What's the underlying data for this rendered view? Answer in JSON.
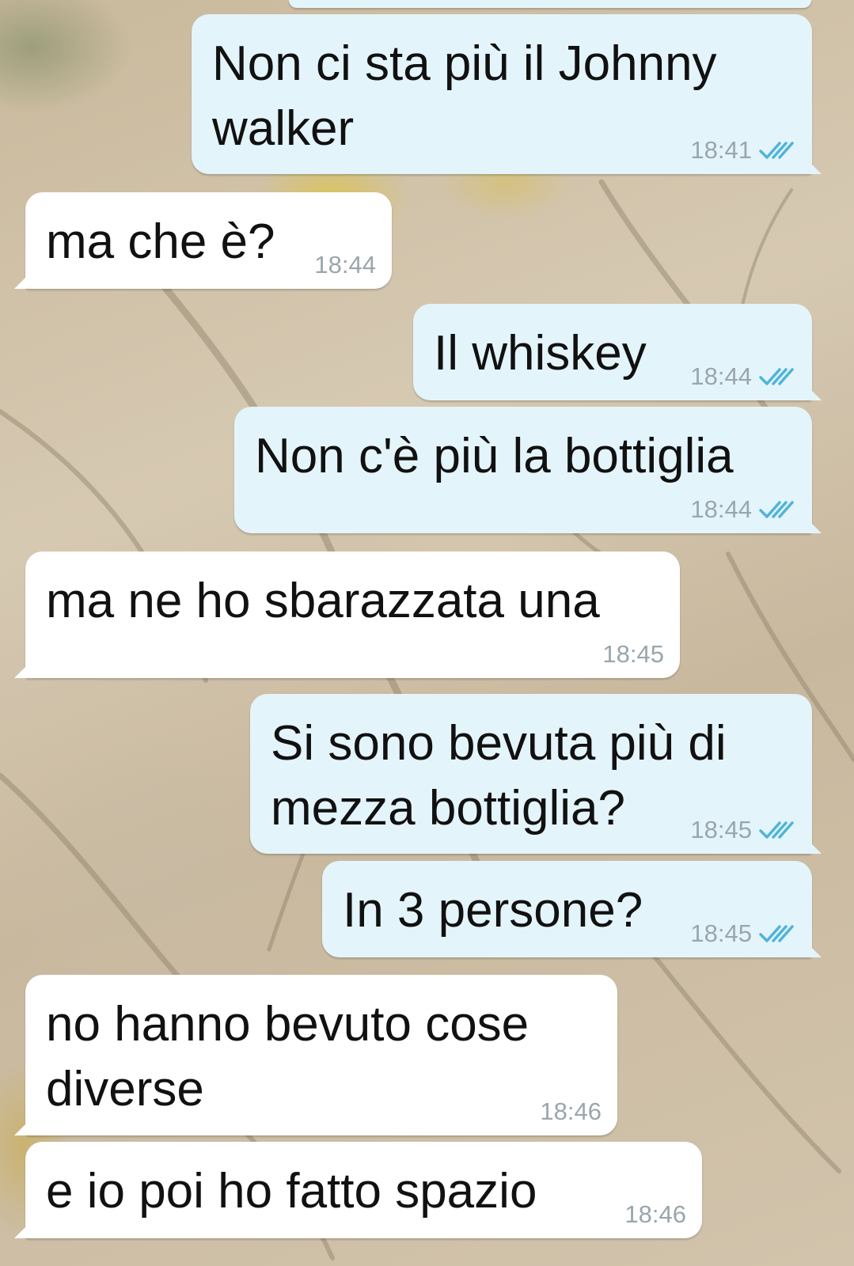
{
  "conversation": {
    "messages": [
      {
        "direction": "outgoing",
        "text": "Non ci sta più il Johnny walker",
        "time": "18:41",
        "status": "read"
      },
      {
        "direction": "incoming",
        "text": "ma che è?",
        "time": "18:44"
      },
      {
        "direction": "outgoing",
        "text": "Il whiskey",
        "time": "18:44",
        "status": "read"
      },
      {
        "direction": "outgoing",
        "text": "Non c'è più la bottiglia",
        "time": "18:44",
        "status": "read"
      },
      {
        "direction": "incoming",
        "text": "ma ne ho sbarazzata una",
        "time": "18:45"
      },
      {
        "direction": "outgoing",
        "text": "Si sono bevuta più di mezza bottiglia?",
        "time": "18:45",
        "status": "read"
      },
      {
        "direction": "outgoing",
        "text": "In 3 persone?",
        "time": "18:45",
        "status": "read"
      },
      {
        "direction": "incoming",
        "text": "no hanno bevuto cose diverse",
        "time": "18:46"
      },
      {
        "direction": "incoming",
        "text": "e io poi ho fatto spazio",
        "time": "18:46"
      }
    ]
  },
  "icons": {
    "read_receipt": "double-check-icon"
  },
  "colors": {
    "outgoing_bubble": "#e4f4fb",
    "incoming_bubble": "#ffffff",
    "timestamp": "#9aa6ad",
    "read_check": "#4fb4d8",
    "text": "#111111"
  }
}
